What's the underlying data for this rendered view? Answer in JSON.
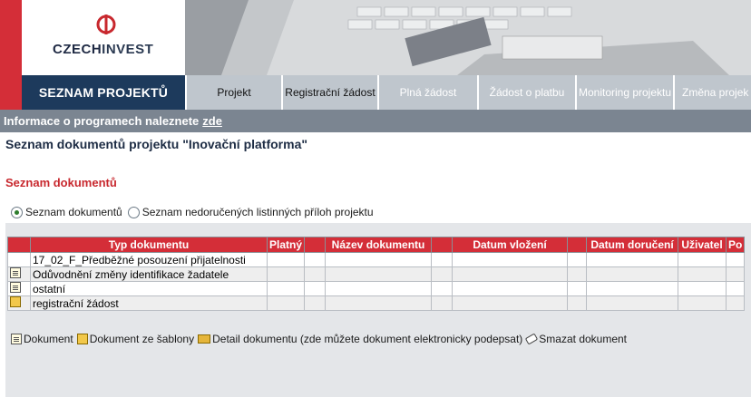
{
  "logo": {
    "text_czech": "CZECH",
    "text_invest": "INVEST"
  },
  "nav": {
    "title": "SEZNAM PROJEKTŮ",
    "tabs": [
      {
        "label": "Projekt",
        "state": "active"
      },
      {
        "label": "Registrační žádost",
        "state": "active"
      },
      {
        "label": "Plná žádost",
        "state": "disabled"
      },
      {
        "label": "Žádost o platbu",
        "state": "disabled"
      },
      {
        "label": "Monitoring projektu",
        "state": "disabled"
      },
      {
        "label": "Změna projek",
        "state": "disabled"
      }
    ]
  },
  "info": {
    "text": "Informace o programech naleznete",
    "link": "zde"
  },
  "page_title": "Seznam dokumentů projektu  \"Inovační platforma\"",
  "section_title": "Seznam dokumentů",
  "radios": [
    {
      "label": "Seznam dokumentů",
      "checked": true
    },
    {
      "label": "Seznam nedoručených listinných příloh projektu",
      "checked": false
    }
  ],
  "table": {
    "headers": [
      "",
      "Typ dokumentu",
      "Platný",
      "",
      "Název dokumentu",
      "",
      "Datum vložení",
      "",
      "Datum doručení",
      "Uživatel",
      "Po"
    ],
    "rows": [
      {
        "icon": "",
        "type": "17_02_F_Předběžné posouzení přijatelnosti"
      },
      {
        "icon": "document-icon",
        "type": "Odůvodnění změny identifikace žadatele"
      },
      {
        "icon": "document-icon",
        "type": "ostatní"
      },
      {
        "icon": "template-icon",
        "type": "registrační žádost"
      }
    ]
  },
  "legend": {
    "document": "Dokument",
    "template": "Dokument ze šablony",
    "detail": "Detail dokumentu (zde můžete dokument elektronicky podepsat)",
    "delete": "Smazat dokument"
  }
}
